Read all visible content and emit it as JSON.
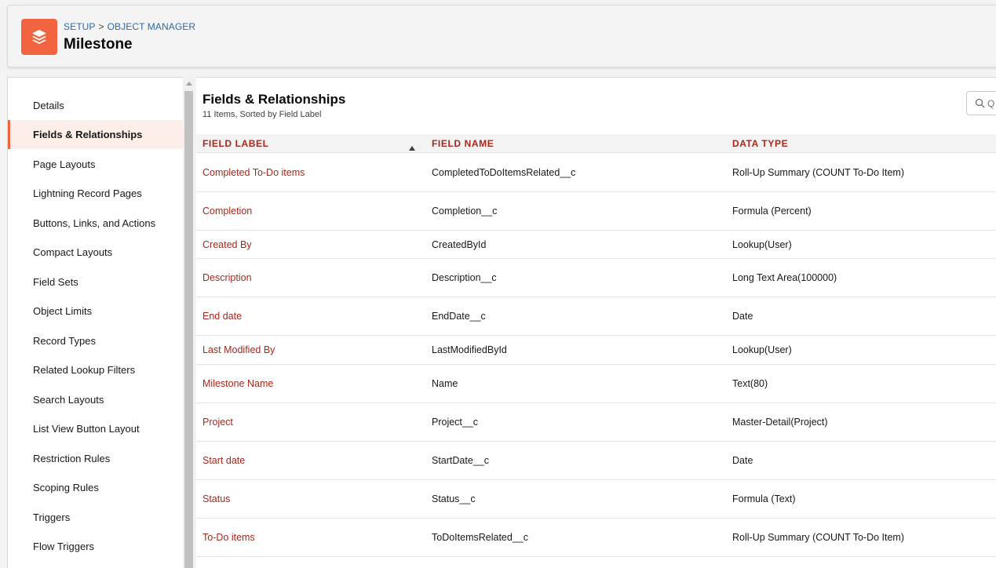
{
  "header": {
    "breadcrumb": [
      "SETUP",
      "OBJECT MANAGER"
    ],
    "breadcrumb_separator": ">",
    "title": "Milestone",
    "icon": "layers-icon",
    "icon_color": "#f2643f"
  },
  "sidebar": {
    "items": [
      {
        "label": "Details"
      },
      {
        "label": "Fields & Relationships",
        "active": true
      },
      {
        "label": "Page Layouts"
      },
      {
        "label": "Lightning Record Pages"
      },
      {
        "label": "Buttons, Links, and Actions"
      },
      {
        "label": "Compact Layouts"
      },
      {
        "label": "Field Sets"
      },
      {
        "label": "Object Limits"
      },
      {
        "label": "Record Types"
      },
      {
        "label": "Related Lookup Filters"
      },
      {
        "label": "Search Layouts"
      },
      {
        "label": "List View Button Layout"
      },
      {
        "label": "Restriction Rules"
      },
      {
        "label": "Scoping Rules"
      },
      {
        "label": "Triggers"
      },
      {
        "label": "Flow Triggers"
      }
    ]
  },
  "main": {
    "title": "Fields & Relationships",
    "subtitle": "11 Items, Sorted by Field Label",
    "search": {
      "placeholder": "Q",
      "icon": "search-icon"
    },
    "columns": [
      "FIELD LABEL",
      "FIELD NAME",
      "DATA TYPE"
    ],
    "sort_column": "FIELD LABEL",
    "sort_direction": "ascending",
    "rows": [
      {
        "label": "Completed To-Do items",
        "name": "CompletedToDoItemsRelated__c",
        "type": "Roll-Up Summary (COUNT To-Do Item)"
      },
      {
        "label": "Completion",
        "name": "Completion__c",
        "type": "Formula (Percent)"
      },
      {
        "label": "Created By",
        "name": "CreatedById",
        "type": "Lookup(User)"
      },
      {
        "label": "Description",
        "name": "Description__c",
        "type": "Long Text Area(100000)"
      },
      {
        "label": "End date",
        "name": "EndDate__c",
        "type": "Date"
      },
      {
        "label": "Last Modified By",
        "name": "LastModifiedById",
        "type": "Lookup(User)"
      },
      {
        "label": "Milestone Name",
        "name": "Name",
        "type": "Text(80)"
      },
      {
        "label": "Project",
        "name": "Project__c",
        "type": "Master-Detail(Project)"
      },
      {
        "label": "Start date",
        "name": "StartDate__c",
        "type": "Date"
      },
      {
        "label": "Status",
        "name": "Status__c",
        "type": "Formula (Text)"
      },
      {
        "label": "To-Do items",
        "name": "ToDoItemsRelated__c",
        "type": "Roll-Up Summary (COUNT To-Do Item)"
      }
    ]
  },
  "colors": {
    "accent": "#f2643f",
    "link": "#a8271b",
    "breadcrumb_link": "#2c6aa9",
    "active_bg": "#fdeee9"
  }
}
